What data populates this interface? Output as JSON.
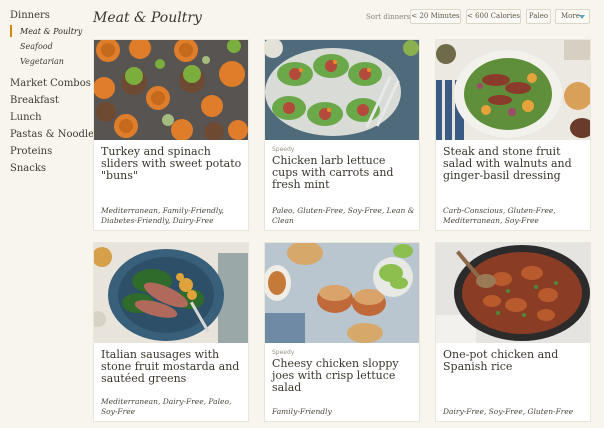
{
  "sidebar": {
    "group_label": "Dinners",
    "sub_items": [
      "Meat & Poultry",
      "Seafood",
      "Vegetarian"
    ],
    "items": [
      "Market Combos",
      "Breakfast",
      "Lunch",
      "Pastas & Noodles",
      "Proteins",
      "Snacks"
    ]
  },
  "header": {
    "title": "Meat & Poultry",
    "sort_label": "Sort dinners",
    "filters": [
      "< 20 Minutes",
      "< 600 Calories",
      "Paleo",
      "More"
    ]
  },
  "recipes": [
    {
      "badge": "",
      "title": "Turkey and spinach sliders with sweet potato \"buns\"",
      "tags": "Mediterranean, Family-Friendly, Diabetes-Friendly, Dairy-Free",
      "image_icon": "sliders-photo"
    },
    {
      "badge": "Speedy",
      "title": "Chicken larb lettuce cups with carrots and fresh mint",
      "tags": "Paleo, Gluten-Free, Soy-Free, Lean & Clean",
      "image_icon": "lettuce-cups-photo"
    },
    {
      "badge": "",
      "title": "Steak and stone fruit salad with walnuts and ginger-basil dressing",
      "tags": "Carb-Conscious, Gluten-Free, Mediterranean, Soy-Free",
      "image_icon": "steak-salad-photo"
    },
    {
      "badge": "",
      "title": "Italian sausages with stone fruit mostarda and sautéed greens",
      "tags": "Mediterranean, Dairy-Free, Paleo, Soy-Free",
      "image_icon": "sausages-photo"
    },
    {
      "badge": "Speedy",
      "title": "Cheesy chicken sloppy joes with crisp lettuce salad",
      "tags": "Family-Friendly",
      "image_icon": "sloppy-joes-photo"
    },
    {
      "badge": "",
      "title": "One-pot chicken and Spanish rice",
      "tags": "Dairy-Free, Soy-Free, Gluten-Free",
      "image_icon": "spanish-rice-photo"
    }
  ],
  "colors": {
    "accent": "#cc8a12",
    "more_caret": "#5aa9c4",
    "background": "#f8f5ee"
  }
}
